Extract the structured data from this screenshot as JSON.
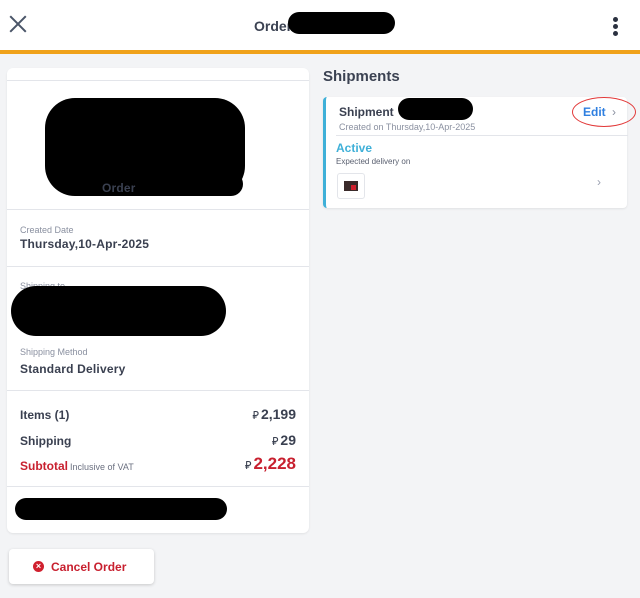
{
  "header": {
    "title": "Order",
    "close_icon": "close-icon",
    "more_icon": "more-vertical-icon"
  },
  "order": {
    "number_label": "Order",
    "created_label": "Created Date",
    "created_value": "Thursday,10-Apr-2025",
    "shipping_to_label": "Shipping to",
    "shipping_method_label": "Shipping Method",
    "shipping_method_value": "Standard Delivery",
    "items_label": "Items (1)",
    "items_currency": "⃁",
    "items_amount": "2,199",
    "shipping_label": "Shipping",
    "shipping_currency": "⃁",
    "shipping_amount": "29",
    "subtotal_label": "Subtotal",
    "subtotal_note": "Inclusive of VAT",
    "subtotal_currency": "⃁",
    "subtotal_amount": "2,228"
  },
  "cancel_button": {
    "label": "Cancel Order",
    "icon": "cancel-circle-icon"
  },
  "shipments": {
    "title": "Shipments",
    "items": [
      {
        "name": "Shipment",
        "created": "Created on Thursday,10-Apr-2025",
        "edit_label": "Edit",
        "status": "Active",
        "expected": "Expected delivery on"
      }
    ]
  },
  "colors": {
    "accent": "#2f7fe0",
    "header_bar": "#f0a21a",
    "danger": "#c8202f",
    "active": "#3fb0d8"
  }
}
